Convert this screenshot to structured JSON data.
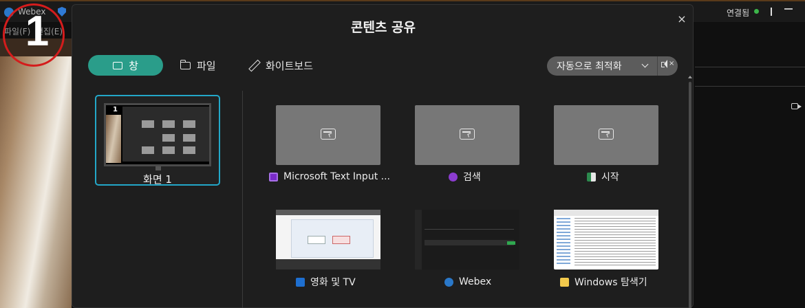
{
  "background_app": {
    "app_name": "Webex",
    "menu": [
      "파일(F)",
      "편집(E)"
    ],
    "status": "연결됨",
    "annotation_number": "1"
  },
  "modal": {
    "title": "콘텐츠 공유",
    "close_symbol": "×",
    "tabs": [
      {
        "label": "창",
        "icon": "window-icon",
        "selected": true
      },
      {
        "label": "파일",
        "icon": "folder-icon",
        "selected": false
      },
      {
        "label": "화이트보드",
        "icon": "pencil-icon",
        "selected": false
      }
    ],
    "optimize": {
      "label": "자동으로 최적화",
      "icon": "chevron-down-icon"
    },
    "mute": {
      "icon": "speaker-muted-icon"
    },
    "screens": [
      {
        "label": "화면 1",
        "selected": true
      }
    ],
    "windows": [
      {
        "label": "Microsoft Text Input ...",
        "icon": "text-input-icon",
        "icon_color": "#7a2bc9",
        "thumbnail": "placeholder"
      },
      {
        "label": "검색",
        "icon": "search-icon",
        "icon_color": "#8b3ccf",
        "thumbnail": "placeholder"
      },
      {
        "label": "시작",
        "icon": "start-icon",
        "icon_color": "#2c8a4e",
        "thumbnail": "placeholder"
      },
      {
        "label": "영화 및 TV",
        "icon": "movies-tv-icon",
        "icon_color": "#1e6fd0",
        "thumbnail": "preview"
      },
      {
        "label": "Webex",
        "icon": "webex-icon",
        "icon_color": "#2a78c9",
        "thumbnail": "preview"
      },
      {
        "label": "Windows 탐색기",
        "icon": "file-explorer-icon",
        "icon_color": "#f2c94c",
        "thumbnail": "preview"
      }
    ]
  },
  "colors": {
    "accent_teal": "#2a9d8a",
    "selection_border": "#23a8c9",
    "annotation_red": "#d41c1c",
    "status_green": "#3cb54a"
  }
}
